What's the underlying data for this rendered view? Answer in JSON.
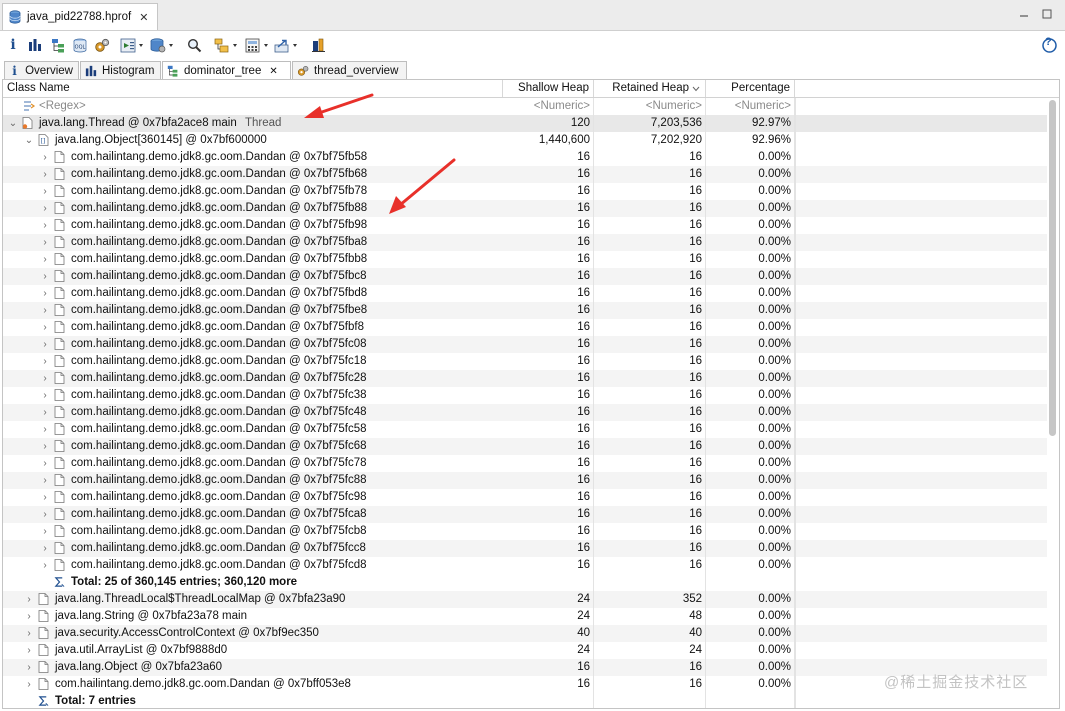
{
  "editor": {
    "file_tab": "java_pid22788.hprof",
    "close_glyph": "✕"
  },
  "toolbar": {
    "info": "i",
    "help": "?"
  },
  "view_tabs": [
    {
      "label": "Overview",
      "close": ""
    },
    {
      "label": "Histogram",
      "close": ""
    },
    {
      "label": "dominator_tree",
      "close": "✕"
    },
    {
      "label": "thread_overview",
      "close": ""
    }
  ],
  "columns": {
    "name": "Class Name",
    "shallow": "Shallow Heap",
    "retained": "Retained Heap",
    "percentage": "Percentage"
  },
  "filter": {
    "name": "<Regex>",
    "shallow": "<Numeric>",
    "retained": "<Numeric>",
    "percentage": "<Numeric>"
  },
  "thread_row": {
    "name": "java.lang.Thread @ 0x7bfa2ace8  main",
    "tag": "Thread",
    "shallow": "120",
    "retained": "7,203,536",
    "percentage": "92.97%"
  },
  "object_row": {
    "name": "java.lang.Object[360145] @ 0x7bf600000",
    "shallow": "1,440,600",
    "retained": "7,202,920",
    "percentage": "92.96%"
  },
  "dandan_rows": [
    {
      "name": "com.hailintang.demo.jdk8.gc.oom.Dandan @ 0x7bf75fb58",
      "shallow": "16",
      "retained": "16",
      "percentage": "0.00%"
    },
    {
      "name": "com.hailintang.demo.jdk8.gc.oom.Dandan @ 0x7bf75fb68",
      "shallow": "16",
      "retained": "16",
      "percentage": "0.00%"
    },
    {
      "name": "com.hailintang.demo.jdk8.gc.oom.Dandan @ 0x7bf75fb78",
      "shallow": "16",
      "retained": "16",
      "percentage": "0.00%"
    },
    {
      "name": "com.hailintang.demo.jdk8.gc.oom.Dandan @ 0x7bf75fb88",
      "shallow": "16",
      "retained": "16",
      "percentage": "0.00%"
    },
    {
      "name": "com.hailintang.demo.jdk8.gc.oom.Dandan @ 0x7bf75fb98",
      "shallow": "16",
      "retained": "16",
      "percentage": "0.00%"
    },
    {
      "name": "com.hailintang.demo.jdk8.gc.oom.Dandan @ 0x7bf75fba8",
      "shallow": "16",
      "retained": "16",
      "percentage": "0.00%"
    },
    {
      "name": "com.hailintang.demo.jdk8.gc.oom.Dandan @ 0x7bf75fbb8",
      "shallow": "16",
      "retained": "16",
      "percentage": "0.00%"
    },
    {
      "name": "com.hailintang.demo.jdk8.gc.oom.Dandan @ 0x7bf75fbc8",
      "shallow": "16",
      "retained": "16",
      "percentage": "0.00%"
    },
    {
      "name": "com.hailintang.demo.jdk8.gc.oom.Dandan @ 0x7bf75fbd8",
      "shallow": "16",
      "retained": "16",
      "percentage": "0.00%"
    },
    {
      "name": "com.hailintang.demo.jdk8.gc.oom.Dandan @ 0x7bf75fbe8",
      "shallow": "16",
      "retained": "16",
      "percentage": "0.00%"
    },
    {
      "name": "com.hailintang.demo.jdk8.gc.oom.Dandan @ 0x7bf75fbf8",
      "shallow": "16",
      "retained": "16",
      "percentage": "0.00%"
    },
    {
      "name": "com.hailintang.demo.jdk8.gc.oom.Dandan @ 0x7bf75fc08",
      "shallow": "16",
      "retained": "16",
      "percentage": "0.00%"
    },
    {
      "name": "com.hailintang.demo.jdk8.gc.oom.Dandan @ 0x7bf75fc18",
      "shallow": "16",
      "retained": "16",
      "percentage": "0.00%"
    },
    {
      "name": "com.hailintang.demo.jdk8.gc.oom.Dandan @ 0x7bf75fc28",
      "shallow": "16",
      "retained": "16",
      "percentage": "0.00%"
    },
    {
      "name": "com.hailintang.demo.jdk8.gc.oom.Dandan @ 0x7bf75fc38",
      "shallow": "16",
      "retained": "16",
      "percentage": "0.00%"
    },
    {
      "name": "com.hailintang.demo.jdk8.gc.oom.Dandan @ 0x7bf75fc48",
      "shallow": "16",
      "retained": "16",
      "percentage": "0.00%"
    },
    {
      "name": "com.hailintang.demo.jdk8.gc.oom.Dandan @ 0x7bf75fc58",
      "shallow": "16",
      "retained": "16",
      "percentage": "0.00%"
    },
    {
      "name": "com.hailintang.demo.jdk8.gc.oom.Dandan @ 0x7bf75fc68",
      "shallow": "16",
      "retained": "16",
      "percentage": "0.00%"
    },
    {
      "name": "com.hailintang.demo.jdk8.gc.oom.Dandan @ 0x7bf75fc78",
      "shallow": "16",
      "retained": "16",
      "percentage": "0.00%"
    },
    {
      "name": "com.hailintang.demo.jdk8.gc.oom.Dandan @ 0x7bf75fc88",
      "shallow": "16",
      "retained": "16",
      "percentage": "0.00%"
    },
    {
      "name": "com.hailintang.demo.jdk8.gc.oom.Dandan @ 0x7bf75fc98",
      "shallow": "16",
      "retained": "16",
      "percentage": "0.00%"
    },
    {
      "name": "com.hailintang.demo.jdk8.gc.oom.Dandan @ 0x7bf75fca8",
      "shallow": "16",
      "retained": "16",
      "percentage": "0.00%"
    },
    {
      "name": "com.hailintang.demo.jdk8.gc.oom.Dandan @ 0x7bf75fcb8",
      "shallow": "16",
      "retained": "16",
      "percentage": "0.00%"
    },
    {
      "name": "com.hailintang.demo.jdk8.gc.oom.Dandan @ 0x7bf75fcc8",
      "shallow": "16",
      "retained": "16",
      "percentage": "0.00%"
    },
    {
      "name": "com.hailintang.demo.jdk8.gc.oom.Dandan @ 0x7bf75fcd8",
      "shallow": "16",
      "retained": "16",
      "percentage": "0.00%"
    }
  ],
  "inner_total": "Total: 25 of 360,145 entries; 360,120 more",
  "top_rows": [
    {
      "name": "java.lang.ThreadLocal$ThreadLocalMap @ 0x7bfa23a90",
      "shallow": "24",
      "retained": "352",
      "percentage": "0.00%"
    },
    {
      "name": "java.lang.String @ 0x7bfa23a78  main",
      "shallow": "24",
      "retained": "48",
      "percentage": "0.00%"
    },
    {
      "name": "java.security.AccessControlContext @ 0x7bf9ec350",
      "shallow": "40",
      "retained": "40",
      "percentage": "0.00%"
    },
    {
      "name": "java.util.ArrayList @ 0x7bf9888d0",
      "shallow": "24",
      "retained": "24",
      "percentage": "0.00%"
    },
    {
      "name": "java.lang.Object @ 0x7bfa23a60",
      "shallow": "16",
      "retained": "16",
      "percentage": "0.00%"
    },
    {
      "name": "com.hailintang.demo.jdk8.gc.oom.Dandan @ 0x7bff053e8",
      "shallow": "16",
      "retained": "16",
      "percentage": "0.00%"
    }
  ],
  "outer_total": "Total: 7 entries",
  "watermark": "@稀土掘金技术社区",
  "colors": {
    "arrow": "#e8302a",
    "selected_row": "#e8e8e8",
    "alt_row": "#f4f4f4"
  }
}
